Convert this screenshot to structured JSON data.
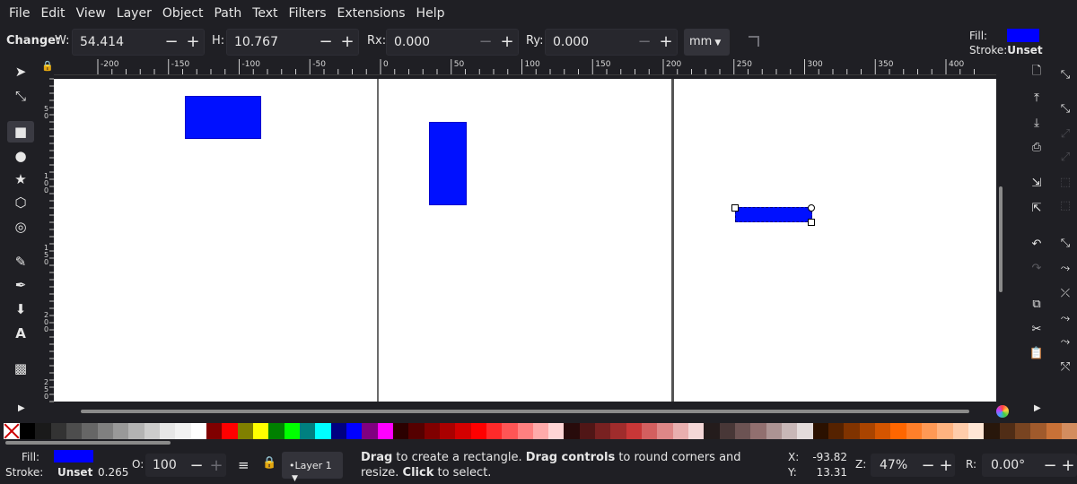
{
  "menu": [
    "File",
    "Edit",
    "View",
    "Layer",
    "Object",
    "Path",
    "Text",
    "Filters",
    "Extensions",
    "Help"
  ],
  "controls": {
    "change_label": "Change:",
    "w_label": "W:",
    "w_value": "54.414",
    "h_label": "H:",
    "h_value": "10.767",
    "rx_label": "Rx:",
    "rx_value": "0.000",
    "ry_label": "Ry:",
    "ry_value": "0.000",
    "unit": "mm",
    "fill_label": "Fill:",
    "stroke_label": "Stroke:",
    "stroke_value": "Unset"
  },
  "ruler": {
    "corner_icon": "lock-icon",
    "top_labels": [
      "-200",
      "-150",
      "-100",
      "-50",
      "0",
      "50",
      "100",
      "150",
      "200",
      "250",
      "300",
      "350",
      "400"
    ],
    "left_labels": [
      "5\n0",
      "1\n0\n0",
      "1\n5\n0",
      "2\n0\n0",
      "2\n5\n0"
    ]
  },
  "tools": [
    "selector-icon",
    "node-icon",
    "rectangle-icon",
    "circle-icon",
    "star-icon",
    "3d-box-icon",
    "spiral-icon",
    "pencil-icon",
    "pen-icon",
    "calligraphy-icon",
    "text-icon",
    "gradient-icon"
  ],
  "commands": [
    "new-document-icon",
    "open-icon",
    "save-icon",
    "print-icon",
    "import-icon",
    "export-icon",
    "undo-icon",
    "redo-icon",
    "copy-icon",
    "cut-icon",
    "paste-icon"
  ],
  "colors": {
    "fill": "#0000ff",
    "rect_fill": "#0010ff",
    "palette": [
      "#000000",
      "#1a1a1a",
      "#333333",
      "#4d4d4d",
      "#666666",
      "#808080",
      "#999999",
      "#b3b3b3",
      "#cccccc",
      "#e6e6e6",
      "#f2f2f2",
      "#ffffff",
      "#800000",
      "#ff0000",
      "#808000",
      "#ffff00",
      "#008000",
      "#00ff00",
      "#008080",
      "#00ffff",
      "#000080",
      "#0000ff",
      "#800080",
      "#ff00ff",
      "#2b0000",
      "#550000",
      "#800000",
      "#aa0000",
      "#d40000",
      "#ff0000",
      "#ff2a2a",
      "#ff5555",
      "#ff8080",
      "#ffaaaa",
      "#ffd5d5",
      "#280b0b",
      "#501616",
      "#782121",
      "#a02c2c",
      "#c83737",
      "#d35f5f",
      "#de8787",
      "#e9afaf",
      "#f4d7d7",
      "#241c1c",
      "#483737",
      "#6c5353",
      "#916f6f",
      "#ac9393",
      "#c8b7b7",
      "#e3dbdb",
      "#2b1100",
      "#552200",
      "#803300",
      "#aa4400",
      "#d45500",
      "#ff6600",
      "#ff7f2a",
      "#ff9955",
      "#ffb380",
      "#ffccaa",
      "#ffe6d5",
      "#28170b",
      "#502d16",
      "#784421",
      "#a05a2c",
      "#c87137",
      "#d38d5f"
    ]
  },
  "status": {
    "fill_label": "Fill:",
    "stroke_label": "Stroke:",
    "stroke_value": "Unset",
    "stroke_width": "0.265",
    "opacity_label": "O:",
    "opacity_value": "100",
    "layer": "•Layer 1",
    "msg_drag1": "Drag",
    "msg_text1": " to create a rectangle. ",
    "msg_drag2": "Drag controls",
    "msg_text2": " to round corners and resize. ",
    "msg_click": "Click",
    "msg_text3": " to select.",
    "x_label": "X:",
    "x_value": "-93.82",
    "y_label": "Y:",
    "y_value": "13.31",
    "zoom_label": "Z:",
    "zoom_value": "47%",
    "rot_label": "R:",
    "rot_value": "0.00°"
  }
}
